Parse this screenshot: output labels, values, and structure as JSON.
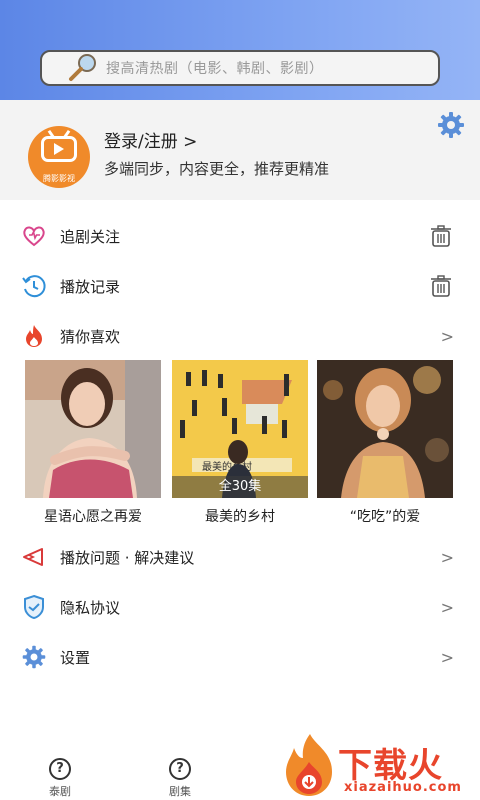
{
  "search": {
    "placeholder": "搜高清热剧（电影、韩剧、影剧）"
  },
  "profile": {
    "login_label": "登录/注册 >",
    "subtitle": "多端同步，内容更全，推荐更精准",
    "avatar_brand": "腾影影视"
  },
  "menu": {
    "follow": "追剧关注",
    "history": "播放记录",
    "guess": "猜你喜欢",
    "problems": "播放问题 · 解决建议",
    "privacy": "隐私协议",
    "settings": "设置",
    "chevron": ">"
  },
  "recommendations": [
    {
      "title": "星语心愿之再爱",
      "badge": ""
    },
    {
      "title": "最美的乡村",
      "badge": "全30集",
      "poster_text": "最美的乡村"
    },
    {
      "title": "“吃吃”的爱",
      "badge": ""
    }
  ],
  "tabs": [
    {
      "label": "泰剧",
      "icon": "question-icon",
      "glyph": "?"
    },
    {
      "label": "剧集",
      "icon": "question-icon",
      "glyph": "?"
    }
  ],
  "watermark": {
    "text": "下载火",
    "url": "xiazaihuo.com"
  },
  "colors": {
    "header_start": "#5c86e6",
    "header_end": "#94b4f6",
    "avatar_orange": "#f08a2a",
    "accent_blue": "#5b8fd8",
    "watermark_red": "#e8452c"
  }
}
